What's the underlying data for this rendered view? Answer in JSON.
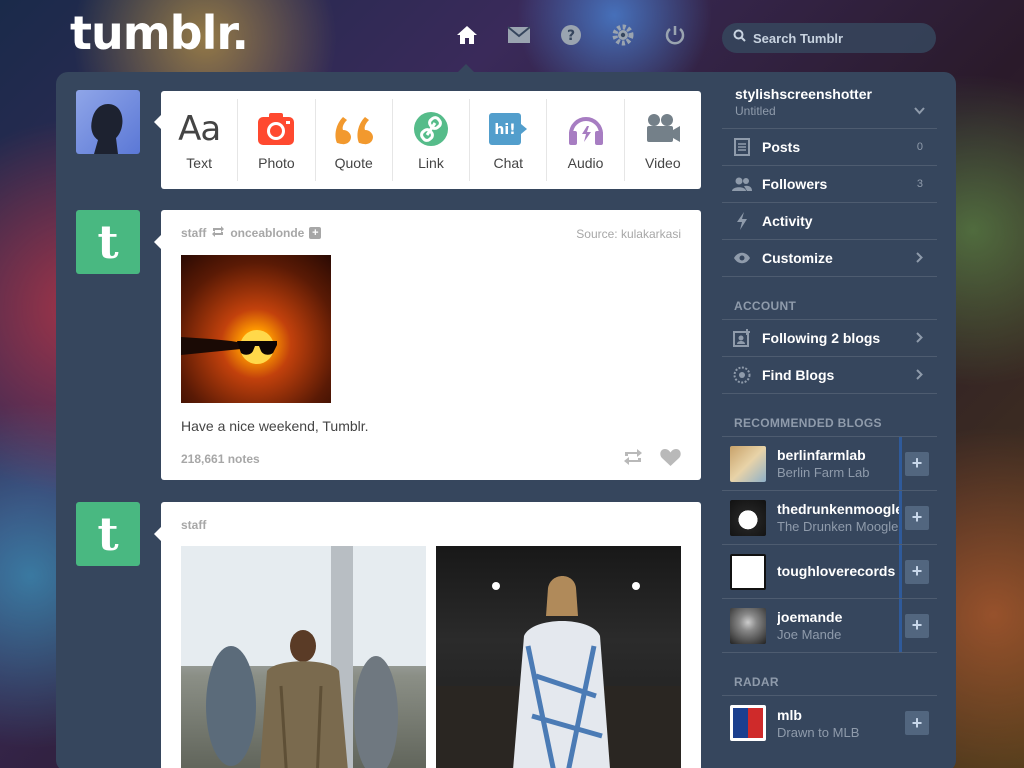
{
  "header": {
    "logo": "tumblr.",
    "search_placeholder": "Search Tumblr",
    "nav": [
      {
        "name": "home-icon"
      },
      {
        "name": "mail-icon"
      },
      {
        "name": "help-icon"
      },
      {
        "name": "settings-icon"
      },
      {
        "name": "power-icon"
      }
    ]
  },
  "post_types": [
    {
      "glyph": "Aa",
      "label": "Text",
      "color": "#444444"
    },
    {
      "label": "Photo",
      "color": "#ff492f"
    },
    {
      "label": "Quote",
      "color": "#f2992e"
    },
    {
      "label": "Link",
      "color": "#56bc8a"
    },
    {
      "label": "Chat",
      "color": "#529ecc",
      "glyph": "hi!"
    },
    {
      "label": "Audio",
      "color": "#a77dc2"
    },
    {
      "label": "Video",
      "color": "#748089"
    }
  ],
  "posts": [
    {
      "author": "staff",
      "reblogged_from": "onceablonde",
      "source_label": "Source:",
      "source_value": "kulakarkasi",
      "caption": "Have a nice weekend, Tumblr.",
      "notes": "218,661 notes"
    },
    {
      "author": "staff"
    }
  ],
  "sidebar": {
    "blog_name": "stylishscreenshotter",
    "blog_title": "Untitled",
    "items": [
      {
        "label": "Posts",
        "count": "0"
      },
      {
        "label": "Followers",
        "count": "3"
      },
      {
        "label": "Activity"
      },
      {
        "label": "Customize"
      }
    ],
    "account_label": "ACCOUNT",
    "account_items": [
      {
        "label": "Following 2 blogs"
      },
      {
        "label": "Find Blogs"
      }
    ],
    "recommended_label": "RECOMMENDED BLOGS",
    "recommended": [
      {
        "name": "berlinfarmlab",
        "title": "Berlin Farm Lab"
      },
      {
        "name": "thedrunkenmoogle",
        "title": "The Drunken Moogle"
      },
      {
        "name": "toughloverecords",
        "title": ""
      },
      {
        "name": "joemande",
        "title": "Joe Mande"
      }
    ],
    "radar_label": "RADAR",
    "radar": {
      "name": "mlb",
      "title": "Drawn to MLB"
    },
    "follow_glyph": "+"
  }
}
